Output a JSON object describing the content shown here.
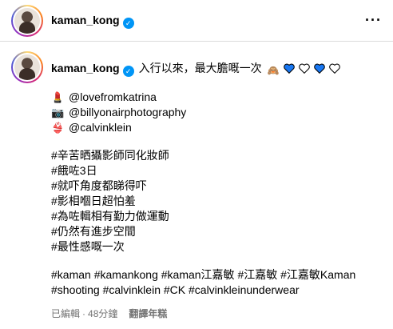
{
  "header": {
    "username": "kaman_kong",
    "verified_glyph": "✓",
    "more_label": "···"
  },
  "caption": {
    "username": "kaman_kong",
    "text": "入行以來，最大膽嘅一次",
    "hearts": [
      {
        "icon": "see-no-evil-monkey-icon",
        "glyph": "🙈"
      },
      {
        "icon": "blue-heart-icon",
        "color": "#1877f2"
      },
      {
        "icon": "white-heart-icon",
        "color": "#ffffff"
      },
      {
        "icon": "blue-heart-icon",
        "color": "#1877f2"
      },
      {
        "icon": "white-heart-icon",
        "color": "#ffffff"
      }
    ],
    "credits": [
      {
        "icon": "lipstick-icon",
        "glyph": "💄",
        "text": "@lovefromkatrina"
      },
      {
        "icon": "camera-icon",
        "glyph": "📷",
        "text": "@billyonairphotography"
      },
      {
        "icon": "bikini-icon",
        "glyph": "👙",
        "text": "@calvinklein"
      }
    ],
    "hashtags_block": [
      "#辛苦晒攝影師同化妝師",
      "#餓咗3日",
      "#就吓角度都睇得吓",
      "#影相嗰日超怕羞",
      "#為咗輯相有勤力做運動",
      "#仍然有進步空間",
      "#最性感嘅一次"
    ],
    "tag_lines": [
      "#kaman #kamankong #kaman江嘉敏 #江嘉敏 #江嘉敏Kaman",
      "#shooting #calvinklein #CK #calvinkleinunderwear"
    ]
  },
  "meta": {
    "edited": "已編輯",
    "time": "48分鐘",
    "translate": "翻譯年糕"
  }
}
